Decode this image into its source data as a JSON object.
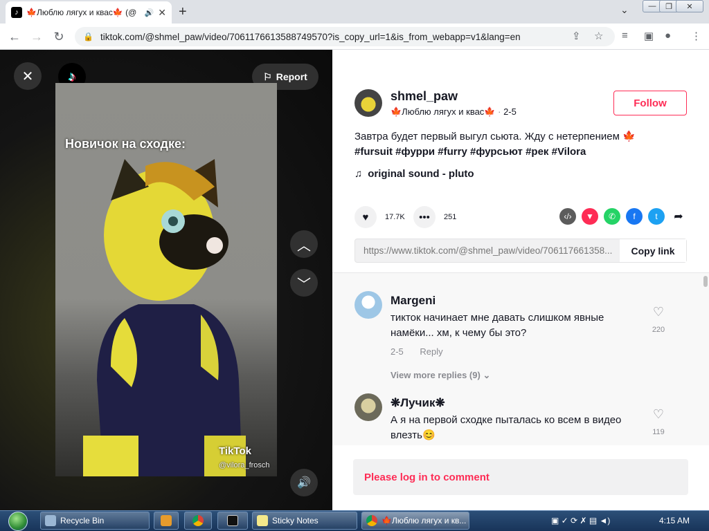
{
  "browser": {
    "tab_title": "🍁Люблю лягух и квас🍁 (@",
    "url": "tiktok.com/@shmel_paw/video/7061176613588749570?is_copy_url=1&is_from_webapp=v1&lang=en"
  },
  "video": {
    "caption": "Новичок на сходке:",
    "report_label": "Report",
    "watermark": "TikTok",
    "watermark_user": "@vilora_frosch"
  },
  "post": {
    "username": "shmel_paw",
    "nickname": "🍁Люблю лягух и квас🍁",
    "date": "2-5",
    "follow_label": "Follow",
    "description": "Завтра будет первый выгул сьюта. Жду с нетерпением 🍁",
    "hashtags": "#fursuit #фурри #furry #фурсьют #рек #Vilora",
    "sound": "original sound - pluto",
    "likes": "17.7K",
    "comments_count": "251",
    "share_link": "https://www.tiktok.com/@shmel_paw/video/706117661358...",
    "copy_label": "Copy link"
  },
  "comments": [
    {
      "name": "Margeni",
      "text": "тикток начинает мне давать слишком явные намёки... хм, к чему бы это?",
      "date": "2-5",
      "reply_label": "Reply",
      "likes": "220",
      "more_replies": "View more replies (9)"
    },
    {
      "name": "❋Лучик❋",
      "text": "А я на первой сходке пыталась ко всем в видео влезть😊",
      "likes": "119"
    }
  ],
  "login_prompt": "Please log in to comment",
  "taskbar": {
    "items": [
      "Recycle Bin",
      "Sticky Notes",
      "🍁Люблю лягух и кв..."
    ],
    "clock": "4:15 AM"
  },
  "colors": {
    "accent": "#fe2c55",
    "share_embed": "#5c5c5c",
    "share_pin": "#fe2c55",
    "share_whatsapp": "#25d366",
    "share_facebook": "#1877f2",
    "share_twitter": "#1da1f2"
  }
}
